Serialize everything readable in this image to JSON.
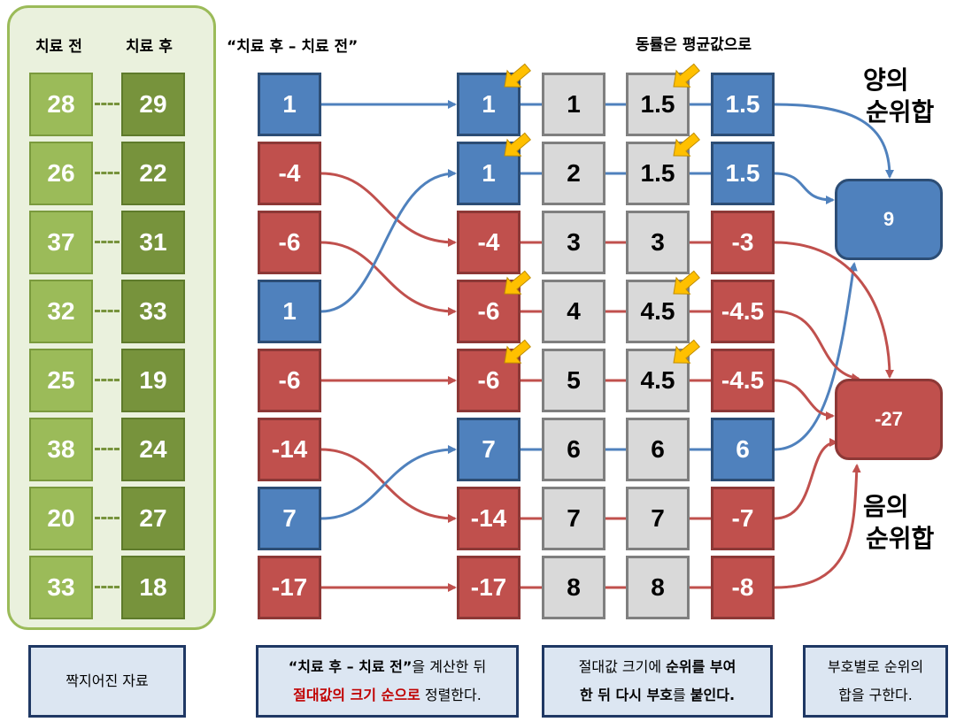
{
  "headers": {
    "before": "치료 전",
    "after": "치료 후",
    "difference": "“치료 후 – 치료 전”",
    "ties": "동률은 평균값으로"
  },
  "paired": {
    "before": [
      "28",
      "26",
      "37",
      "32",
      "25",
      "38",
      "20",
      "33"
    ],
    "after": [
      "29",
      "22",
      "31",
      "33",
      "19",
      "24",
      "27",
      "18"
    ]
  },
  "differences": [
    {
      "value": "1",
      "sign": "pos"
    },
    {
      "value": "-4",
      "sign": "neg"
    },
    {
      "value": "-6",
      "sign": "neg"
    },
    {
      "value": "1",
      "sign": "pos"
    },
    {
      "value": "-6",
      "sign": "neg"
    },
    {
      "value": "-14",
      "sign": "neg"
    },
    {
      "value": "7",
      "sign": "pos"
    },
    {
      "value": "-17",
      "sign": "neg"
    }
  ],
  "sorted": [
    {
      "value": "1",
      "sign": "pos"
    },
    {
      "value": "1",
      "sign": "pos"
    },
    {
      "value": "-4",
      "sign": "neg"
    },
    {
      "value": "-6",
      "sign": "neg"
    },
    {
      "value": "-6",
      "sign": "neg"
    },
    {
      "value": "7",
      "sign": "pos"
    },
    {
      "value": "-14",
      "sign": "neg"
    },
    {
      "value": "-17",
      "sign": "neg"
    }
  ],
  "order": [
    "1",
    "2",
    "3",
    "4",
    "5",
    "6",
    "7",
    "8"
  ],
  "ranks": [
    "1.5",
    "1.5",
    "3",
    "4.5",
    "4.5",
    "6",
    "7",
    "8"
  ],
  "signed_ranks": [
    {
      "value": "1.5",
      "sign": "pos"
    },
    {
      "value": "1.5",
      "sign": "pos"
    },
    {
      "value": "-3",
      "sign": "neg"
    },
    {
      "value": "-4.5",
      "sign": "neg"
    },
    {
      "value": "-4.5",
      "sign": "neg"
    },
    {
      "value": "6",
      "sign": "pos"
    },
    {
      "value": "-7",
      "sign": "neg"
    },
    {
      "value": "-8",
      "sign": "neg"
    }
  ],
  "results": {
    "positive_value": "9",
    "negative_value": "-27",
    "positive_label_1": "양의",
    "positive_label_2": "순위합",
    "negative_label_1": "음의",
    "negative_label_2": "순위합"
  },
  "captions": {
    "c1": "짝지어진 자료",
    "c2_a": "“치료 후 – 치료 전”",
    "c2_b": "을 계산한 뒤",
    "c2_c": "절대값의 크기 순으로",
    "c2_d": " 정렬한다.",
    "c3_a": "절대값 크기에 ",
    "c3_b": "순위를 부여",
    "c3_c": "한 뒤 다시 부호",
    "c3_d": "를 ",
    "c3_e": "붙인다.",
    "c4_a": "부호별로 순위의",
    "c4_b": "합을 구한다."
  },
  "colors": {
    "positive": "#4f81bd",
    "negative": "#c0504d",
    "neutral": "#d9d9d9",
    "paired_before": "#9bbb59",
    "paired_after": "#77933c",
    "tie_marker": "#ffc000"
  }
}
